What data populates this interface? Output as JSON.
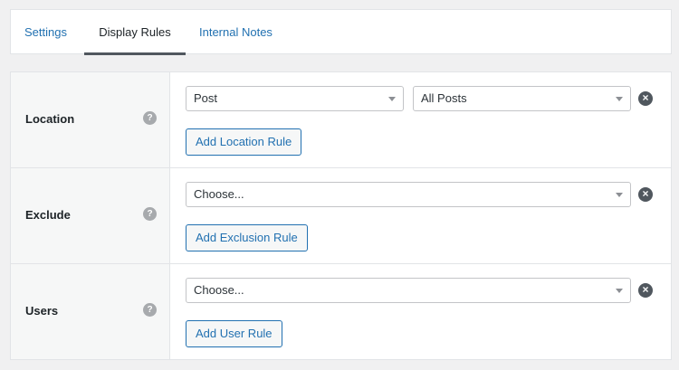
{
  "tabs": [
    {
      "label": "Settings"
    },
    {
      "label": "Display Rules"
    },
    {
      "label": "Internal Notes"
    }
  ],
  "rows": {
    "location": {
      "label": "Location",
      "help": "?",
      "select_type": "Post",
      "select_value": "All Posts",
      "remove": "×",
      "button": "Add Location Rule"
    },
    "exclude": {
      "label": "Exclude",
      "help": "?",
      "select": "Choose...",
      "remove": "×",
      "button": "Add Exclusion Rule"
    },
    "users": {
      "label": "Users",
      "help": "?",
      "select": "Choose...",
      "remove": "×",
      "button": "Add User Rule"
    }
  }
}
